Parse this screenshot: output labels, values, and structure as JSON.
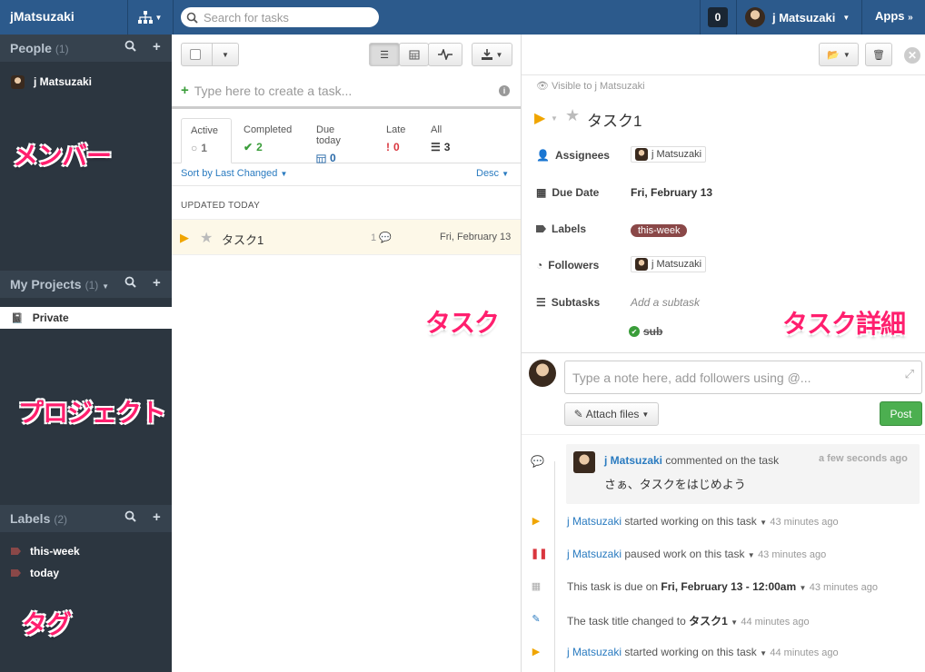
{
  "topbar": {
    "brand": "jMatsuzaki",
    "search_placeholder": "Search for tasks",
    "notifications": "0",
    "user": "j Matsuzaki",
    "apps": "Apps"
  },
  "sidebar": {
    "people": {
      "title": "People",
      "count": "(1)",
      "items": [
        "j Matsuzaki"
      ]
    },
    "projects": {
      "title": "My Projects",
      "count": "(1)",
      "items": [
        "Private"
      ]
    },
    "labels": {
      "title": "Labels",
      "count": "(2)",
      "items": [
        "this-week",
        "today"
      ]
    }
  },
  "annotations": {
    "members": "メンバー",
    "projects": "プロジェクト",
    "tags": "タグ",
    "tasks": "タスク",
    "task_detail": "タスク詳細"
  },
  "tasklist": {
    "new_task_placeholder": "Type here to create a task...",
    "tabs": [
      {
        "label": "Active",
        "value": "1",
        "icon": "○",
        "color": "#999999"
      },
      {
        "label": "Completed",
        "value": "2",
        "icon": "✔",
        "color": "#3a9d3a"
      },
      {
        "label": "Due today",
        "value": "0",
        "icon": "▦",
        "color": "#2a6aa8"
      },
      {
        "label": "Late",
        "value": "0",
        "icon": "!",
        "color": "#d9363e"
      },
      {
        "label": "All",
        "value": "3",
        "icon": "☰",
        "color": "#333333"
      }
    ],
    "sort_label": "Sort by Last Changed",
    "order_label": "Desc",
    "section": "UPDATED TODAY",
    "tasks": [
      {
        "title": "タスク1",
        "comments": "1",
        "due": "Fri, February 13"
      }
    ]
  },
  "detail": {
    "visibility": "Visible to j Matsuzaki",
    "title": "タスク1",
    "assignees_label": "Assignees",
    "assignee": "j Matsuzaki",
    "due_label": "Due Date",
    "due": "Fri, February 13",
    "labels_label": "Labels",
    "label": "this-week",
    "followers_label": "Followers",
    "follower": "j Matsuzaki",
    "subtasks_label": "Subtasks",
    "add_subtask_placeholder": "Add a subtask",
    "subtask": "sub",
    "note_placeholder": "Type a note here, add followers using @...",
    "attach_label": "Attach files",
    "post_label": "Post"
  },
  "feed": {
    "comment": {
      "user": "j Matsuzaki",
      "action": "commented on the task",
      "ago": "a few seconds ago",
      "text": "さぁ、タスクをはじめよう"
    },
    "items": [
      {
        "icon": "▶",
        "color": "#f0a500",
        "user": "j Matsuzaki",
        "text": "started working on this task",
        "ago": "43 minutes ago"
      },
      {
        "icon": "❚❚",
        "color": "#d9363e",
        "user": "j Matsuzaki",
        "text": "paused work on this task",
        "ago": "43 minutes ago"
      },
      {
        "icon": "▦",
        "color": "#aaaaaa",
        "user": "",
        "text": "This task is due on",
        "strong": "Fri, February 13 - 12:00am",
        "ago": "43 minutes ago"
      },
      {
        "icon": "✎",
        "color": "#2a7bc0",
        "user": "",
        "text": "The task title changed to",
        "strong": "タスク1",
        "ago": "44 minutes ago"
      },
      {
        "icon": "▶",
        "color": "#f0a500",
        "user": "j Matsuzaki",
        "text": "started working on this task",
        "ago": "44 minutes ago"
      }
    ]
  }
}
